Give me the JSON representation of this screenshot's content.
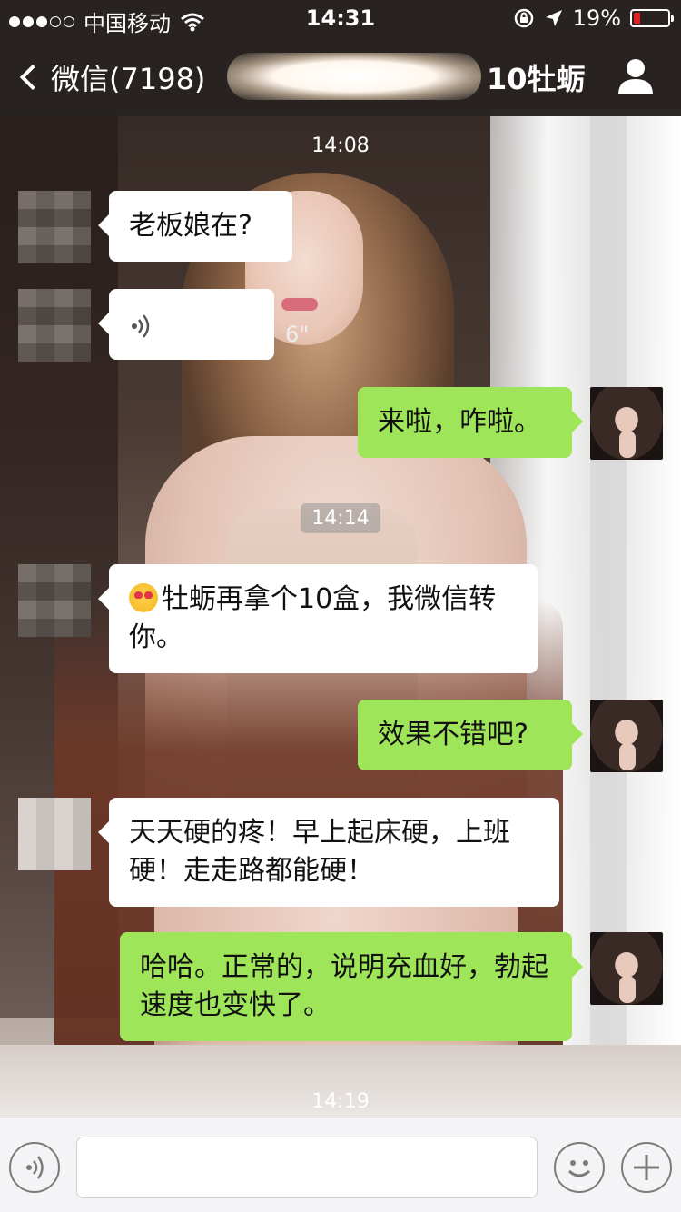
{
  "status_bar": {
    "carrier": "中国移动",
    "time": "14:31",
    "battery_percent": "19%",
    "battery_level": 0.19,
    "battery_color": "#e02020"
  },
  "nav": {
    "back_label": "微信(7198)",
    "title_visible": "10牡蛎",
    "profile_icon": "person-icon"
  },
  "messages": [
    {
      "type": "timestamp",
      "text": "14:08"
    },
    {
      "type": "text",
      "side": "left",
      "text": "老板娘在?"
    },
    {
      "type": "voice",
      "side": "left",
      "duration": "6\""
    },
    {
      "type": "text",
      "side": "right",
      "text": "来啦，咋啦。"
    },
    {
      "type": "timestamp",
      "text": "14:14"
    },
    {
      "type": "text",
      "side": "left",
      "emoji": "heart-eyes-emoji",
      "text": "牡蛎再拿个10盒，我微信转你。"
    },
    {
      "type": "text",
      "side": "right",
      "text": "效果不错吧?"
    },
    {
      "type": "text",
      "side": "left",
      "text": "天天硬的疼！早上起床硬，上班硬！走走路都能硬！"
    },
    {
      "type": "text",
      "side": "right",
      "text": "哈哈。正常的，说明充血好，勃起速度也变快了。"
    },
    {
      "type": "timestamp",
      "text": "14:19"
    }
  ],
  "input_bar": {
    "voice_button_icon": "voice-icon",
    "text_value": "",
    "emoji_button_icon": "smiley-icon",
    "plus_button_icon": "plus-icon"
  },
  "colors": {
    "bubble_right": "#9fe55a",
    "bubble_left": "#ffffff",
    "navbar": "#282422"
  }
}
